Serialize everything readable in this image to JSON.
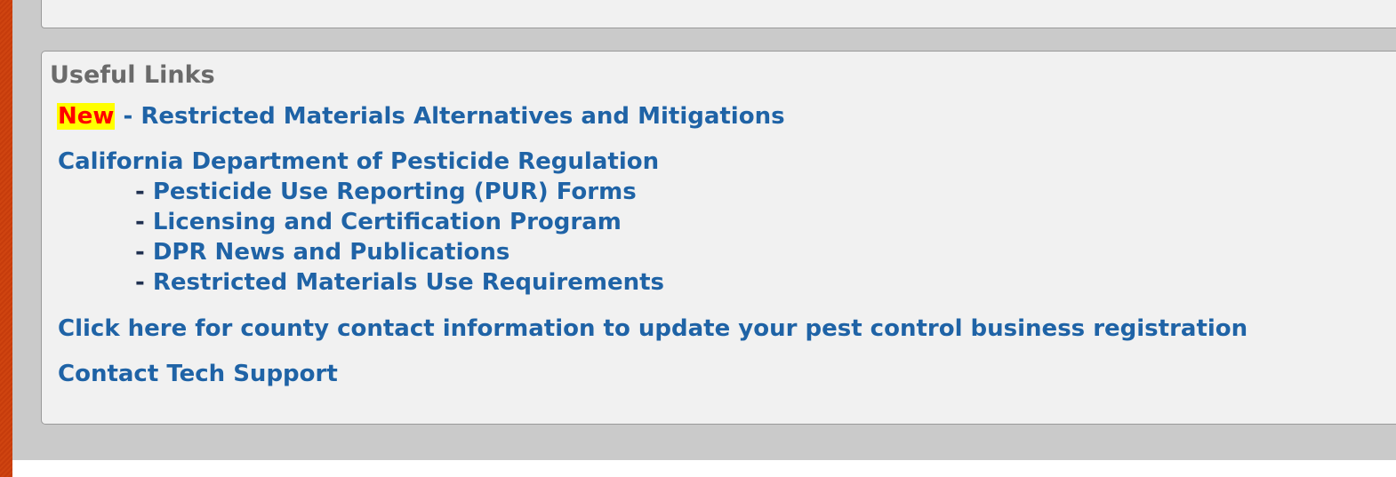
{
  "top_panel": {},
  "useful_links": {
    "title": "Useful Links",
    "new_item": {
      "badge": "New",
      "separator": " - ",
      "label": "Restricted Materials Alternatives and Mitigations"
    },
    "dpr": {
      "label": "California Department of Pesticide Regulation",
      "sub_links": [
        {
          "dash": "- ",
          "label": "Pesticide Use Reporting (PUR) Forms"
        },
        {
          "dash": "- ",
          "label": "Licensing and Certification Program"
        },
        {
          "dash": "- ",
          "label": "DPR News and Publications"
        },
        {
          "dash": "- ",
          "label": "Restricted Materials Use Requirements"
        }
      ]
    },
    "county_contact": {
      "label": "Click here for county contact information to update your pest control business registration"
    },
    "tech_support": {
      "label": "Contact Tech Support"
    }
  },
  "colors": {
    "link": "#1f63a6",
    "title": "#6a6a6a",
    "new_badge_bg": "#ffff00",
    "new_badge_text": "#ff0000",
    "panel_bg": "#f1f1f1",
    "page_bg": "#cacaca",
    "frame_accent": "#cf4410"
  }
}
